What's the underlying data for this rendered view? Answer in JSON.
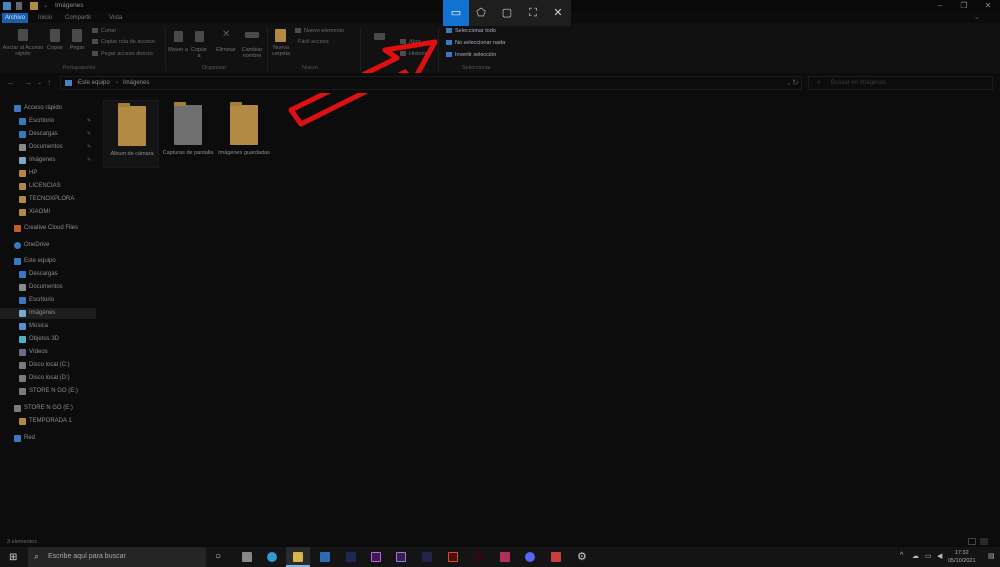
{
  "window": {
    "title": "Imágenes"
  },
  "tabs": [
    "Archivo",
    "Inicio",
    "Compartir",
    "Vista"
  ],
  "ribbon": {
    "pin_label": "Anclar al Acceso rápido",
    "copy": "Copiar",
    "paste": "Pegar",
    "cut": "Cortar",
    "copy_path": "Copiar ruta de acceso",
    "paste_shortcut": "Pegar acceso directo",
    "group_clipboard": "Portapapeles",
    "move": "Mover a",
    "copy_to": "Copiar a",
    "delete": "Eliminar",
    "rename": "Cambiar nombre",
    "group_organize": "Organizar",
    "new_folder": "Nueva carpeta",
    "new_item": "Nuevo elemento",
    "easy_access": "Fácil acceso",
    "group_new": "Nuevo",
    "open": "Abrir",
    "history": "Historial",
    "select_all": "Seleccionar todo",
    "select_none": "No seleccionar nada",
    "invert": "Invertir selección",
    "group_select": "Seleccionar"
  },
  "address": {
    "crumbs": [
      "Este equipo",
      "Imágenes"
    ],
    "search_placeholder": "Buscar en Imágenes"
  },
  "nav": {
    "quick_access": "Acceso rápido",
    "quick_items": [
      "Escritorio",
      "Descargas",
      "Documentos",
      "Imágenes",
      "HP",
      "LICENCIAS",
      "TECNOXPLORA",
      "XIAOMI"
    ],
    "creative": "Creative Cloud Files",
    "onedrive": "OneDrive",
    "this_pc": "Este equipo",
    "pc_items": [
      "Descargas",
      "Documentos",
      "Escritorio",
      "Imágenes",
      "Música",
      "Objetos 3D",
      "Vídeos",
      "Disco local (C:)",
      "Disco local (D:)",
      "STORE N GO (E:)"
    ],
    "usb": "STORE N GO (E:)",
    "usb_items": [
      "TEMPORADA 1"
    ],
    "network": "Red"
  },
  "folders": [
    "Álbum de cámara",
    "Capturas de pantalla",
    "Imágenes guardadas"
  ],
  "status": {
    "count": "3 elementos"
  },
  "taskbar": {
    "search_placeholder": "Escribe aquí para buscar",
    "time": "17:32",
    "date": "05/10/2021"
  },
  "colors": {
    "accent": "#1272d2",
    "folder": "#b38a44",
    "arrow": "#e01010"
  }
}
